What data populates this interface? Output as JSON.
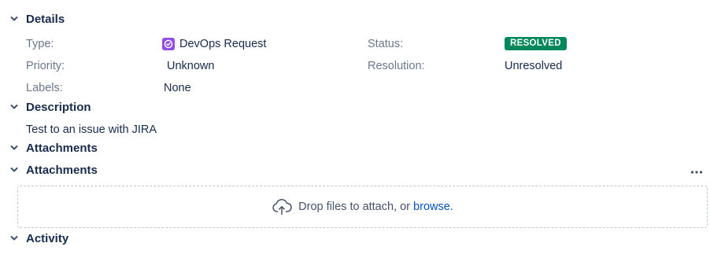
{
  "sections": {
    "details": "Details",
    "description": "Description",
    "attachments_1": "Attachments",
    "attachments_2": "Attachments",
    "activity": "Activity"
  },
  "details": {
    "type_label": "Type:",
    "type_value": "DevOps Request",
    "type_icon": "check-circle-icon",
    "priority_label": "Priority:",
    "priority_value": "Unknown",
    "labels_label": "Labels:",
    "labels_value": "None",
    "status_label": "Status:",
    "status_value": "RESOLVED",
    "resolution_label": "Resolution:",
    "resolution_value": "Unresolved"
  },
  "description": {
    "text": "Test to an issue with JIRA"
  },
  "attachments": {
    "drop_text": "Drop files to attach, or",
    "browse_text": "browse."
  },
  "colors": {
    "status_resolved": "#00875a",
    "type_icon_bg": "#904ee2",
    "link": "#0052cc",
    "label": "#6b778c",
    "text": "#172b4d"
  }
}
